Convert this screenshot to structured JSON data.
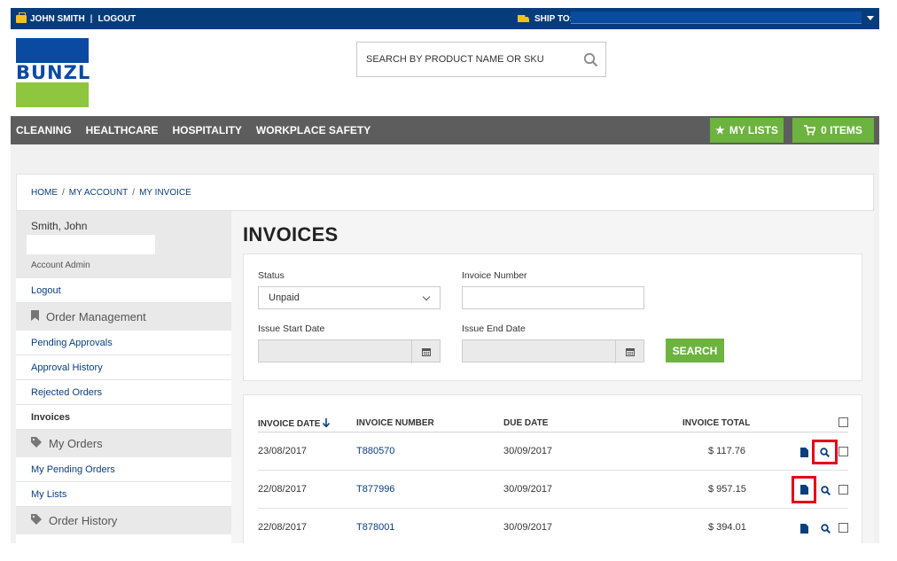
{
  "topbar": {
    "user_name": "JOHN SMITH",
    "logout": "LOGOUT",
    "ship_to_label": "SHIP TO:",
    "briefcase_icon": "briefcase-icon",
    "truck_icon": "truck-icon"
  },
  "header": {
    "logo_text": "BUNZL",
    "search_placeholder": "SEARCH BY PRODUCT NAME OR SKU"
  },
  "nav": {
    "items": [
      "CLEANING",
      "HEALTHCARE",
      "HOSPITALITY",
      "WORKPLACE SAFETY"
    ],
    "my_lists": "MY LISTS",
    "cart": "0 ITEMS"
  },
  "breadcrumb": [
    "HOME",
    "MY ACCOUNT",
    "MY INVOICE"
  ],
  "sidebar": {
    "user_name": "Smith, John",
    "role": "Account Admin",
    "logout": "Logout",
    "sections": [
      {
        "title": "Order Management",
        "links": [
          "Pending Approvals",
          "Approval History",
          "Rejected Orders",
          "Invoices"
        ]
      },
      {
        "title": "My Orders",
        "links": [
          "My Pending Orders",
          "My Lists"
        ]
      },
      {
        "title": "Order History",
        "links": []
      }
    ],
    "active_link": "Invoices"
  },
  "main": {
    "title": "INVOICES",
    "filter": {
      "status_label": "Status",
      "status_value": "Unpaid",
      "invoice_number_label": "Invoice Number",
      "invoice_number_value": "",
      "issue_start_label": "Issue Start Date",
      "issue_end_label": "Issue End Date",
      "search_button": "SEARCH"
    },
    "table": {
      "headers": [
        "INVOICE DATE",
        "INVOICE NUMBER",
        "DUE DATE",
        "INVOICE TOTAL"
      ],
      "rows": [
        {
          "date": "23/08/2017",
          "number": "T880570",
          "due": "30/09/2017",
          "total": "$ 117.76"
        },
        {
          "date": "22/08/2017",
          "number": "T877996",
          "due": "30/09/2017",
          "total": "$ 957.15"
        },
        {
          "date": "22/08/2017",
          "number": "T878001",
          "due": "30/09/2017",
          "total": "$ 394.01"
        }
      ]
    }
  },
  "colors": {
    "topbar": "#073c7a",
    "brand_blue": "#0a4aa0",
    "brand_green": "#8ec63f",
    "button_green": "#6cb33f",
    "nav_grey": "#5d5d5d",
    "highlight_red": "#e4001b"
  }
}
